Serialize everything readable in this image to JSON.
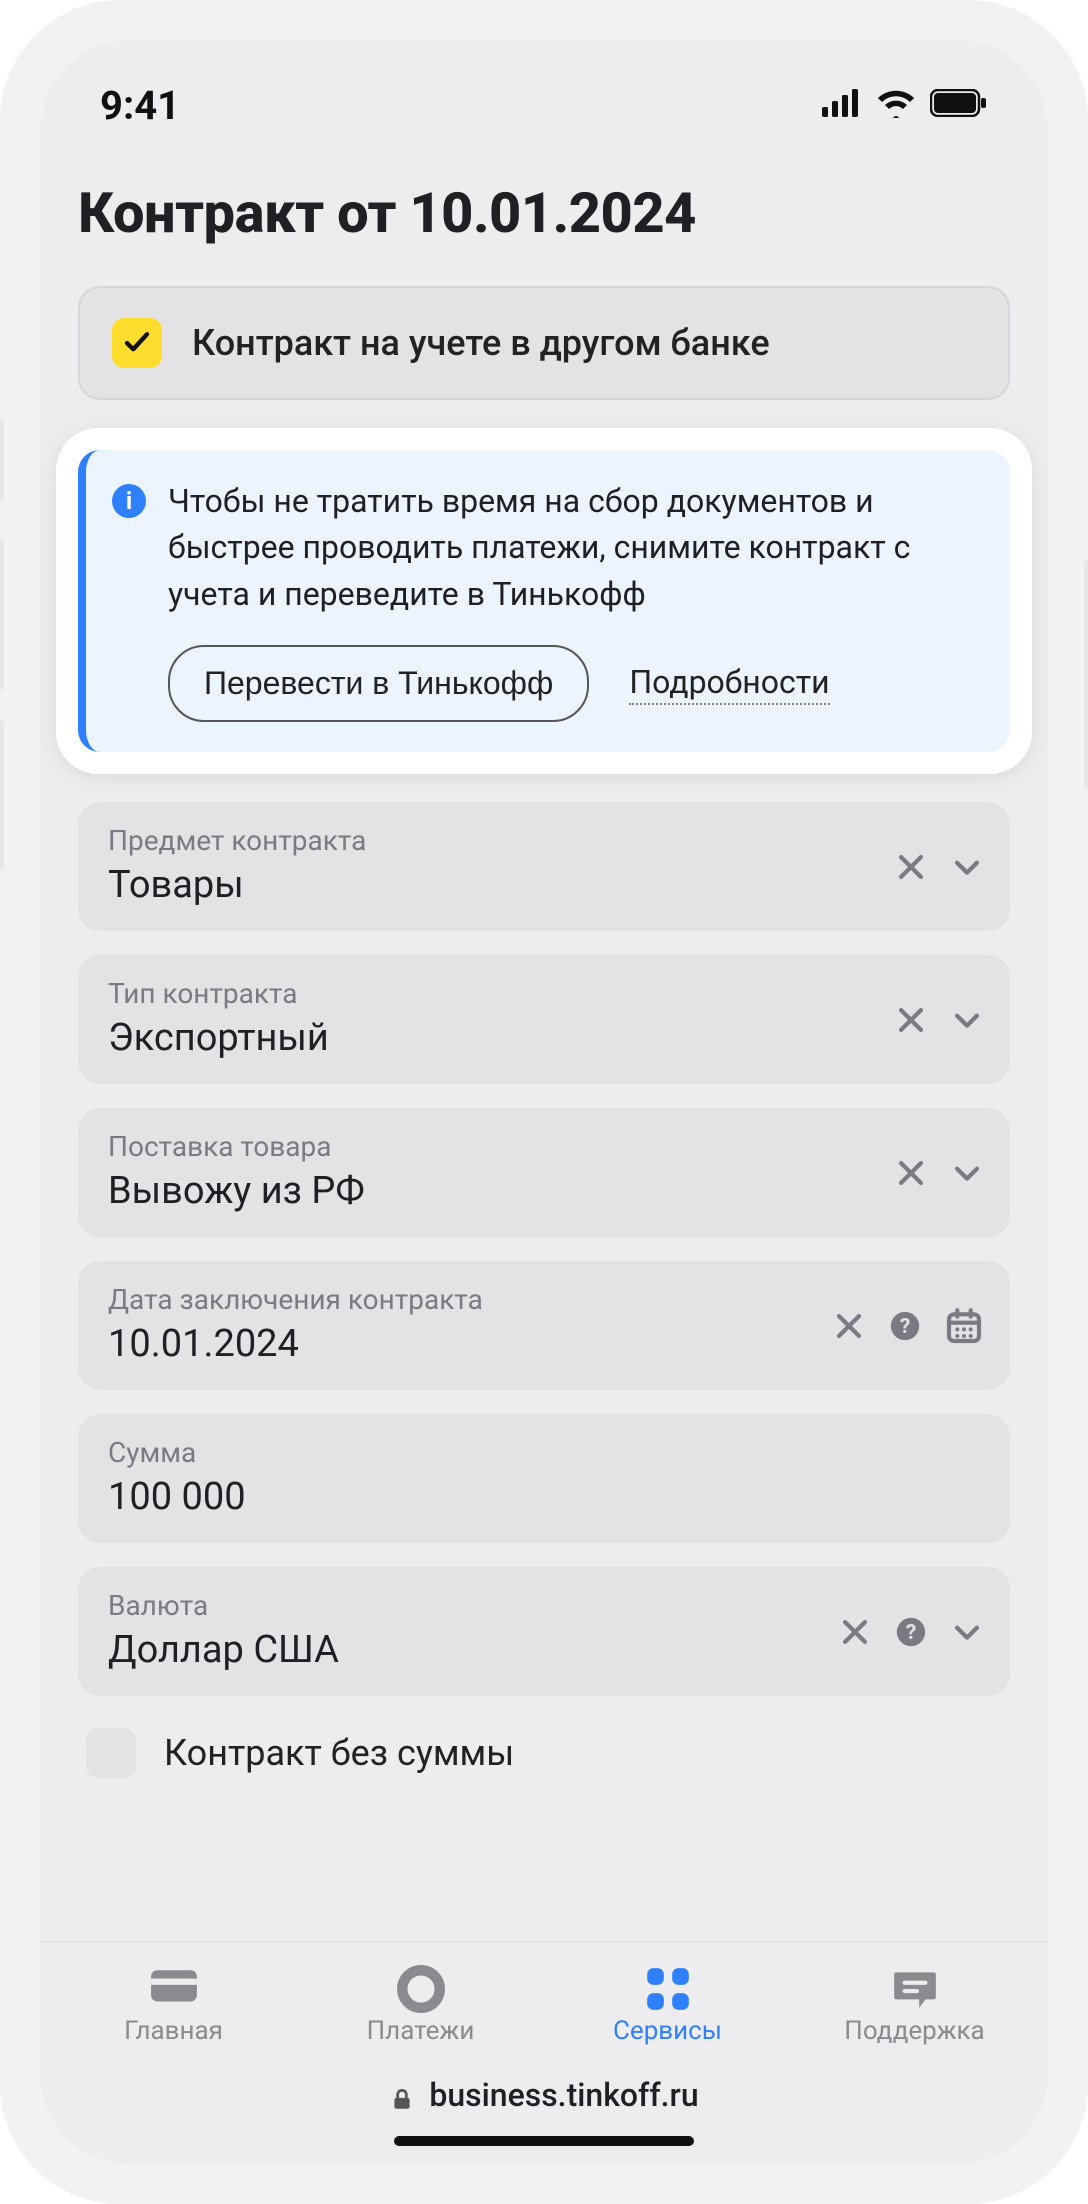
{
  "status": {
    "time": "9:41"
  },
  "page": {
    "title": "Контракт от 10.01.2024"
  },
  "checkbox_another_bank": {
    "label": "Контракт на учете в другом банке",
    "checked": true
  },
  "banner": {
    "text": "Чтобы не тратить время на сбор документов и быстрее проводить платежи, снимите контракт с учета и переведите в Тинькофф",
    "primary_btn": "Перевести в Тинькофф",
    "more_link": "Подробности"
  },
  "fields": {
    "subject": {
      "label": "Предмет контракта",
      "value": "Товары"
    },
    "type": {
      "label": "Тип контракта",
      "value": "Экспортный"
    },
    "delivery": {
      "label": "Поставка товара",
      "value": "Вывожу из РФ"
    },
    "date": {
      "label": "Дата заключения контракта",
      "value": "10.01.2024"
    },
    "sum": {
      "label": "Сумма",
      "value": "100 000"
    },
    "currency": {
      "label": "Валюта",
      "value": "Доллар США"
    }
  },
  "checkbox_no_sum": {
    "label": "Контракт без суммы",
    "checked": false
  },
  "nav": {
    "home": "Главная",
    "payments": "Платежи",
    "services": "Сервисы",
    "support": "Поддержка",
    "active": "services"
  },
  "url": "business.tinkoff.ru"
}
